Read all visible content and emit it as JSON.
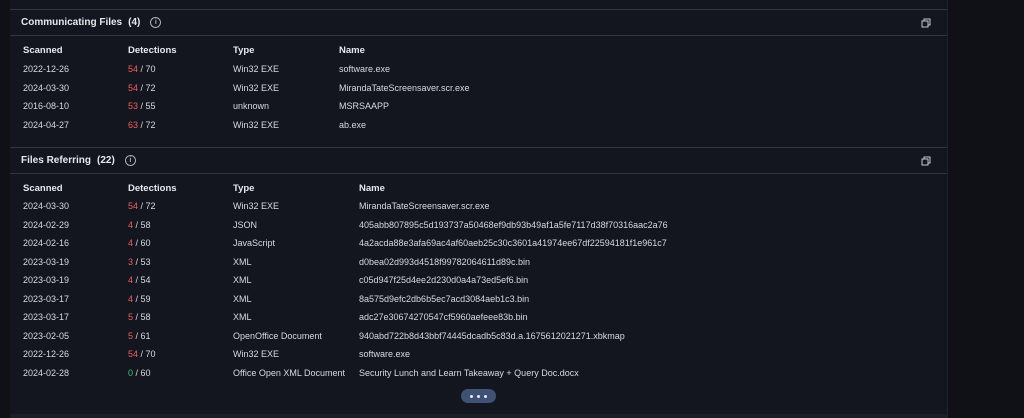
{
  "communicating": {
    "title": "Communicating Files",
    "count": "(4)",
    "headers": {
      "scanned": "Scanned",
      "detections": "Detections",
      "type": "Type",
      "name": "Name"
    },
    "rows": [
      {
        "scanned": "2022-12-26",
        "det_hits": "54",
        "det_total": " / 70",
        "type": "Win32 EXE",
        "name": "software.exe"
      },
      {
        "scanned": "2024-03-30",
        "det_hits": "54",
        "det_total": " / 72",
        "type": "Win32 EXE",
        "name": "MirandaTateScreensaver.scr.exe"
      },
      {
        "scanned": "2016-08-10",
        "det_hits": "53",
        "det_total": " / 55",
        "type": "unknown",
        "name": "MSRSAAPP"
      },
      {
        "scanned": "2024-04-27",
        "det_hits": "63",
        "det_total": " / 72",
        "type": "Win32 EXE",
        "name": "ab.exe"
      }
    ]
  },
  "referring": {
    "title": "Files Referring",
    "count": "(22)",
    "headers": {
      "scanned": "Scanned",
      "detections": "Detections",
      "type": "Type",
      "name": "Name"
    },
    "rows": [
      {
        "scanned": "2024-03-30",
        "det_hits": "54",
        "det_total": " / 72",
        "type": "Win32 EXE",
        "name": "MirandaTateScreensaver.scr.exe"
      },
      {
        "scanned": "2024-02-29",
        "det_hits": "4",
        "det_total": " / 58",
        "type": "JSON",
        "name": "405abb807895c5d193737a50468ef9db93b49af1a5fe7117d38f70316aac2a76"
      },
      {
        "scanned": "2024-02-16",
        "det_hits": "4",
        "det_total": " / 60",
        "type": "JavaScript",
        "name": "4a2acda88e3afa69ac4af60aeb25c30c3601a41974ee67df22594181f1e961c7"
      },
      {
        "scanned": "2023-03-19",
        "det_hits": "3",
        "det_total": " / 53",
        "type": "XML",
        "name": "d0bea02d993d4518f99782064611d89c.bin"
      },
      {
        "scanned": "2023-03-19",
        "det_hits": "4",
        "det_total": " / 54",
        "type": "XML",
        "name": "c05d947f25d4ee2d230d0a4a73ed5ef6.bin"
      },
      {
        "scanned": "2023-03-17",
        "det_hits": "4",
        "det_total": " / 59",
        "type": "XML",
        "name": "8a575d9efc2db6b5ec7acd3084aeb1c3.bin"
      },
      {
        "scanned": "2023-03-17",
        "det_hits": "5",
        "det_total": " / 58",
        "type": "XML",
        "name": "adc27e30674270547cf5960aefeee83b.bin"
      },
      {
        "scanned": "2023-02-05",
        "det_hits": "5",
        "det_total": " / 61",
        "type": "OpenOffice Document",
        "name": "940abd722b8d43bbf74445dcadb5c83d.a.1675612021271.xbkmap"
      },
      {
        "scanned": "2022-12-26",
        "det_hits": "54",
        "det_total": " / 70",
        "type": "Win32 EXE",
        "name": "software.exe"
      },
      {
        "scanned": "2024-02-28",
        "det_hits": "0",
        "det_total": " / 60",
        "type": "Office Open XML Document",
        "name": "Security Lunch and Learn Takeaway + Query Doc.docx"
      }
    ]
  },
  "icons": {
    "info": "info-icon",
    "copy": "copy-icon",
    "more": "more-dots-icon"
  },
  "colors": {
    "detection_hit": "#f05d5d",
    "detection_zero": "#3fc380",
    "more_button": "#3f5275"
  }
}
